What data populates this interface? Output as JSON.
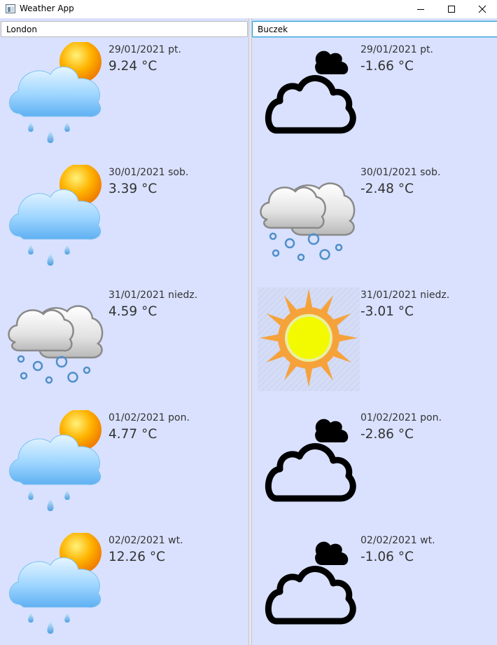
{
  "window": {
    "title": "Weather App"
  },
  "columns": [
    {
      "city": "London",
      "days": [
        {
          "date": "29/01/2021 pt.",
          "temp": "9.24 °C",
          "icon": "sun-cloud-rain-icon"
        },
        {
          "date": "30/01/2021 sob.",
          "temp": "3.39 °C",
          "icon": "sun-cloud-rain-icon"
        },
        {
          "date": "31/01/2021 niedz.",
          "temp": "4.59 °C",
          "icon": "snow-clouds-icon"
        },
        {
          "date": "01/02/2021 pon.",
          "temp": "4.77 °C",
          "icon": "sun-cloud-rain-icon"
        },
        {
          "date": "02/02/2021 wt.",
          "temp": "12.26 °C",
          "icon": "sun-cloud-rain-icon"
        }
      ]
    },
    {
      "city": "Buczek",
      "days": [
        {
          "date": "29/01/2021 pt.",
          "temp": "-1.66 °C",
          "icon": "cloud-outline-icon"
        },
        {
          "date": "30/01/2021 sob.",
          "temp": "-2.48 °C",
          "icon": "snow-clouds-icon"
        },
        {
          "date": "31/01/2021 niedz.",
          "temp": "-3.01 °C",
          "icon": "sun-icon"
        },
        {
          "date": "01/02/2021 pon.",
          "temp": "-2.86 °C",
          "icon": "cloud-outline-icon"
        },
        {
          "date": "02/02/2021 wt.",
          "temp": "-1.06 °C",
          "icon": "cloud-outline-icon"
        }
      ]
    }
  ]
}
